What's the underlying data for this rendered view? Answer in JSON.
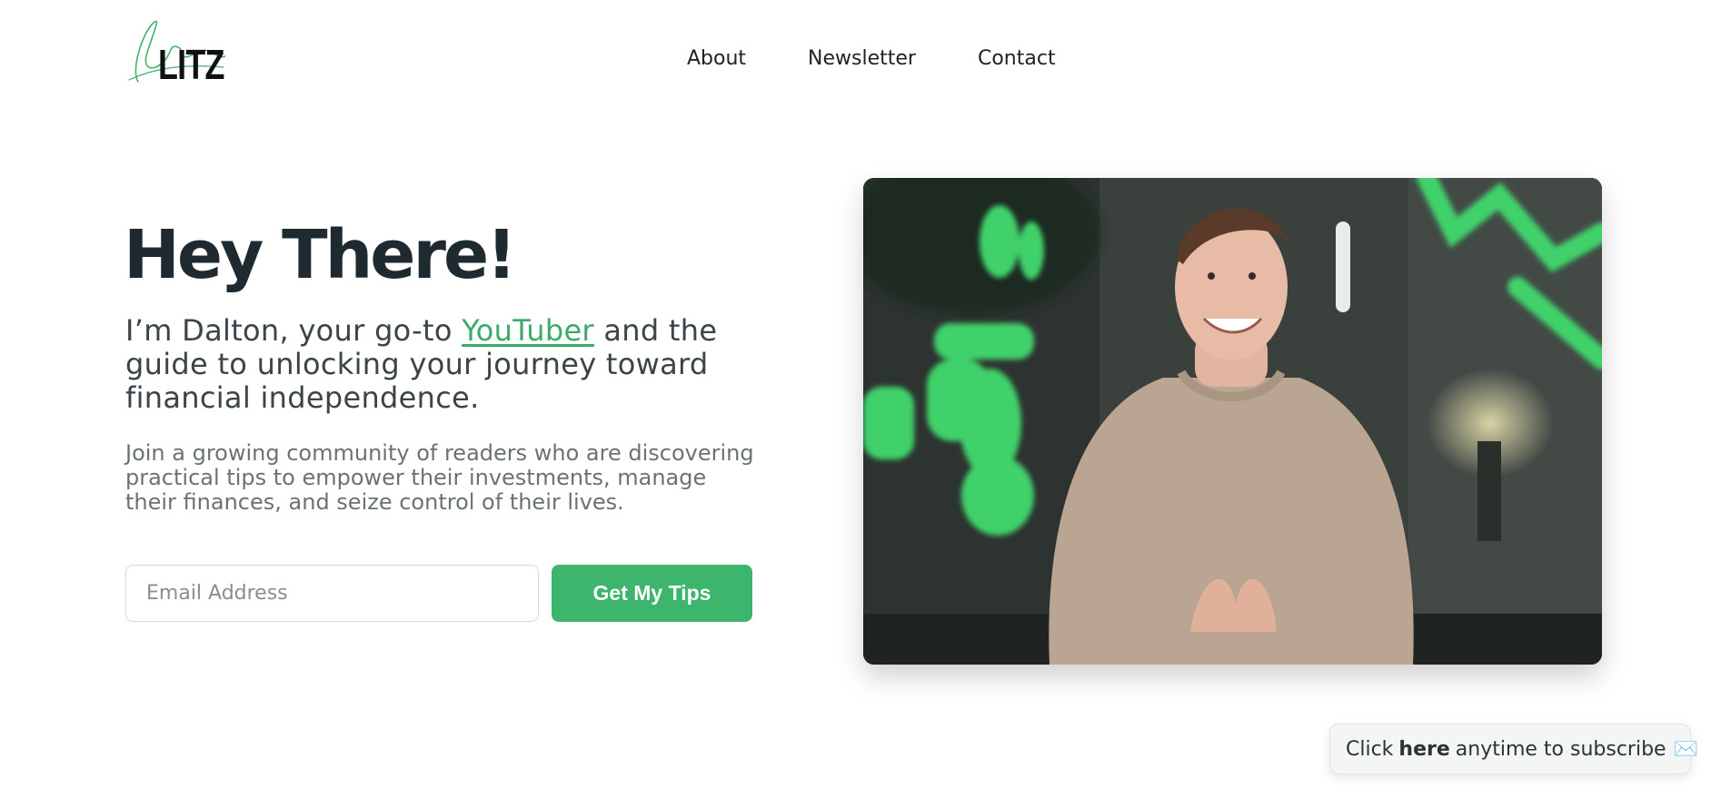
{
  "brand": {
    "logo_script": "Dalton",
    "logo_word": "LITZ",
    "accent_color": "#3db56c"
  },
  "nav": {
    "items": [
      {
        "label": "About"
      },
      {
        "label": "Newsletter"
      },
      {
        "label": "Contact"
      }
    ]
  },
  "hero": {
    "title": "Hey There!",
    "subtitle_before": "I’m Dalton, your go-to ",
    "subtitle_link": "YouTuber",
    "subtitle_after": " and the guide to unlocking your journey toward financial independence.",
    "description": "Join a growing community of readers who are discovering practical tips to empower their investments, manage their finances, and seize control of their lives."
  },
  "form": {
    "email_placeholder": "Email Address",
    "email_value": "",
    "button_label": "Get My Tips"
  },
  "subscribe_pill": {
    "prefix": "Click",
    "bold": "here",
    "suffix": "anytime to subscribe",
    "icon": "envelope-icon",
    "icon_glyph": "✉️"
  }
}
